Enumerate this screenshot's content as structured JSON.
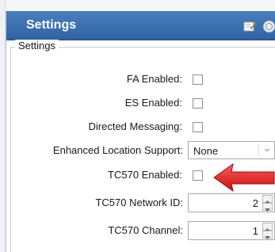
{
  "panel": {
    "title": "Settings",
    "icons": [
      "edit-icon",
      "round-icon"
    ]
  },
  "group": {
    "legend": "Settings"
  },
  "fields": [
    {
      "label": "FA Enabled:",
      "type": "checkbox",
      "checked": false
    },
    {
      "label": "ES Enabled:",
      "type": "checkbox",
      "checked": false
    },
    {
      "label": "Directed Messaging:",
      "type": "checkbox",
      "checked": false
    },
    {
      "label": "Enhanced Location Support:",
      "type": "select",
      "value": "None"
    },
    {
      "label": "TC570 Enabled:",
      "type": "checkbox",
      "checked": false
    },
    {
      "label": "TC570 Network ID:",
      "type": "spinner",
      "value": "2"
    },
    {
      "label": "TC570 Channel:",
      "type": "spinner",
      "value": "1"
    }
  ],
  "annotation": {
    "type": "arrow-icon",
    "color": "#e02020"
  },
  "colors": {
    "header": "#3a6fb0",
    "header_text": "#ffffff"
  }
}
